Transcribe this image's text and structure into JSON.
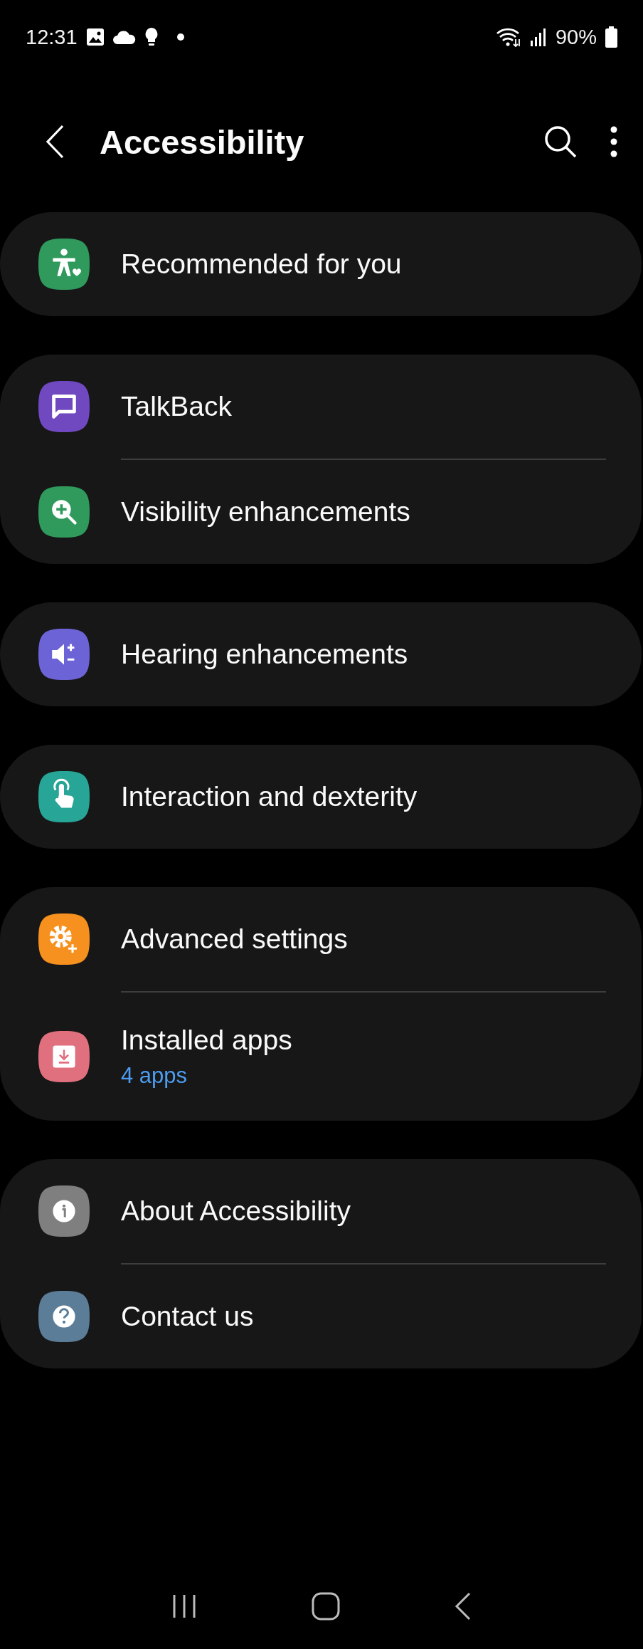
{
  "status_bar": {
    "time": "12:31",
    "battery": "90%"
  },
  "header": {
    "title": "Accessibility"
  },
  "groups": [
    {
      "items": [
        {
          "kind": "person",
          "color": "#2f9a5c",
          "label": "Recommended for you"
        }
      ]
    },
    {
      "items": [
        {
          "kind": "speech",
          "color": "#7048c0",
          "label": "TalkBack"
        },
        {
          "kind": "magnifier",
          "color": "#2f9a5c",
          "label": "Visibility enhancements"
        }
      ]
    },
    {
      "items": [
        {
          "kind": "speaker",
          "color": "#6b63d6",
          "label": "Hearing enhancements"
        }
      ]
    },
    {
      "items": [
        {
          "kind": "touch",
          "color": "#27a596",
          "label": "Interaction and dexterity"
        }
      ]
    },
    {
      "items": [
        {
          "kind": "gear",
          "color": "#f6901e",
          "label": "Advanced settings"
        },
        {
          "kind": "download",
          "color": "#e0707e",
          "label": "Installed apps",
          "subtitle": "4 apps"
        }
      ]
    },
    {
      "items": [
        {
          "kind": "info",
          "color": "#7f7f7f",
          "label": "About Accessibility"
        },
        {
          "kind": "help",
          "color": "#5b7d98",
          "label": "Contact us"
        }
      ]
    }
  ]
}
